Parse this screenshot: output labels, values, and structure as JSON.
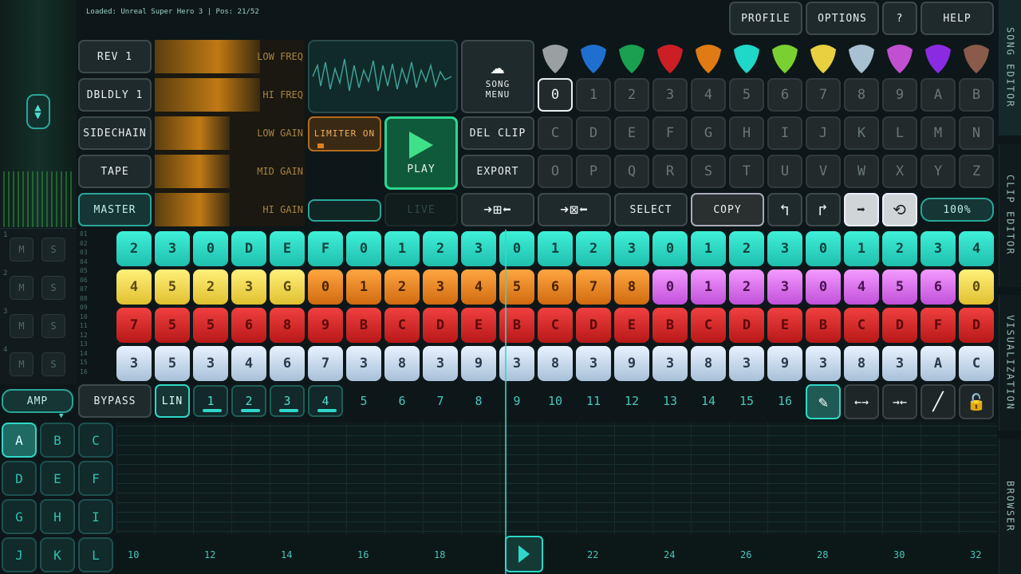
{
  "status": "Loaded: Unreal Super Hero 3 | Pos: 21/52",
  "top_menu": {
    "profile": "PROFILE",
    "options": "OPTIONS",
    "help_q": "?",
    "help": "HELP"
  },
  "side_tabs": [
    "SONG EDITOR",
    "CLIP EDITOR",
    "VISUALIZATION",
    "BROWSER"
  ],
  "fx_buttons": [
    "REV 1",
    "DBLDLY 1",
    "SIDECHAIN",
    "TAPE",
    "MASTER"
  ],
  "eq_labels": [
    "LOW FREQ",
    "HI FREQ",
    "LOW GAIN",
    "MID GAIN",
    "HI GAIN"
  ],
  "eq_levels": [
    0.7,
    0.7,
    0.5,
    0.5,
    0.5
  ],
  "limiter": "LIMITER ON",
  "play": "PLAY",
  "live": "LIVE",
  "song_menu": "SONG MENU",
  "del_clip": "DEL CLIP",
  "export": "EXPORT",
  "select": "SELECT",
  "copy": "COPY",
  "zoom": "100%",
  "pick_colors": [
    "#9aa0a2",
    "#1f6fcf",
    "#1aa050",
    "#cc1f25",
    "#e07a14",
    "#1fd8c8",
    "#7ad030",
    "#e8d040",
    "#a9c0d2",
    "#c050d0",
    "#8a2be2",
    "#8a5a4a"
  ],
  "keypad": [
    [
      "0",
      "1",
      "2",
      "3",
      "4",
      "5",
      "6",
      "7",
      "8",
      "9",
      "A",
      "B"
    ],
    [
      "C",
      "D",
      "E",
      "F",
      "G",
      "H",
      "I",
      "J",
      "K",
      "L",
      "M",
      "N"
    ],
    [
      "O",
      "P",
      "Q",
      "R",
      "S",
      "T",
      "U",
      "V",
      "W",
      "X",
      "Y",
      "Z"
    ]
  ],
  "track_labels": [
    "1",
    "2",
    "3",
    "4"
  ],
  "ms": [
    "M",
    "S"
  ],
  "row_numbers": [
    "01",
    "02",
    "03",
    "04",
    "05",
    "06",
    "07",
    "08",
    "09",
    "10",
    "11",
    "12",
    "13",
    "14",
    "15",
    "16"
  ],
  "rows": [
    {
      "cells": [
        "2",
        "3",
        "0",
        "D",
        "E",
        "F",
        "0",
        "1",
        "2",
        "3",
        "0",
        "1",
        "2",
        "3",
        "0",
        "1",
        "2",
        "3",
        "0",
        "1",
        "2",
        "3",
        "4"
      ],
      "colors": [
        "r1",
        "r1",
        "r1",
        "r1",
        "r1",
        "r1",
        "r1",
        "r1",
        "r1",
        "r1",
        "r1",
        "r1",
        "r1",
        "r1",
        "r1",
        "r1",
        "r1",
        "r1",
        "r1",
        "r1",
        "r1",
        "r1",
        "r1"
      ]
    },
    {
      "cells": [
        "4",
        "5",
        "2",
        "3",
        "G",
        "0",
        "1",
        "2",
        "3",
        "4",
        "5",
        "6",
        "7",
        "8",
        "0",
        "1",
        "2",
        "3",
        "0",
        "4",
        "5",
        "6",
        "0"
      ],
      "colors": [
        "y",
        "y",
        "y",
        "y",
        "y",
        "o",
        "o",
        "o",
        "o",
        "o",
        "o",
        "o",
        "o",
        "o",
        "p",
        "p",
        "p",
        "p",
        "p",
        "p",
        "p",
        "p",
        "y"
      ]
    },
    {
      "cells": [
        "7",
        "5",
        "5",
        "6",
        "8",
        "9",
        "B",
        "C",
        "D",
        "E",
        "B",
        "C",
        "D",
        "E",
        "B",
        "C",
        "D",
        "E",
        "B",
        "C",
        "D",
        "F",
        "D"
      ],
      "colors": [
        "rd",
        "rd",
        "rd",
        "rd",
        "rd",
        "rd",
        "rd",
        "rd",
        "rd",
        "rd",
        "rd",
        "rd",
        "rd",
        "rd",
        "rd",
        "rd",
        "rd",
        "rd",
        "rd",
        "rd",
        "rd",
        "rd",
        "rd"
      ]
    },
    {
      "cells": [
        "3",
        "5",
        "3",
        "4",
        "6",
        "7",
        "3",
        "8",
        "3",
        "9",
        "3",
        "8",
        "3",
        "9",
        "3",
        "8",
        "3",
        "9",
        "3",
        "8",
        "3",
        "A",
        "C"
      ],
      "colors": [
        "lb",
        "lb",
        "lb",
        "lb",
        "lb",
        "lb",
        "lb",
        "lb",
        "lb",
        "lb",
        "lb",
        "lb",
        "lb",
        "lb",
        "lb",
        "lb",
        "lb",
        "lb",
        "lb",
        "lb",
        "lb",
        "lb",
        "lb"
      ]
    }
  ],
  "amp": "AMP",
  "bypass": "BYPASS",
  "lin": "LIN",
  "step_numbers": [
    "1",
    "2",
    "3",
    "4",
    "5",
    "6",
    "7",
    "8",
    "9",
    "10",
    "11",
    "12",
    "13",
    "14",
    "15",
    "16"
  ],
  "letters": [
    "A",
    "B",
    "C",
    "D",
    "E",
    "F",
    "G",
    "H",
    "I",
    "J",
    "K",
    "L"
  ],
  "timeline": [
    "10",
    "12",
    "14",
    "16",
    "18",
    "20",
    "22",
    "24",
    "26",
    "28",
    "30",
    "32"
  ]
}
